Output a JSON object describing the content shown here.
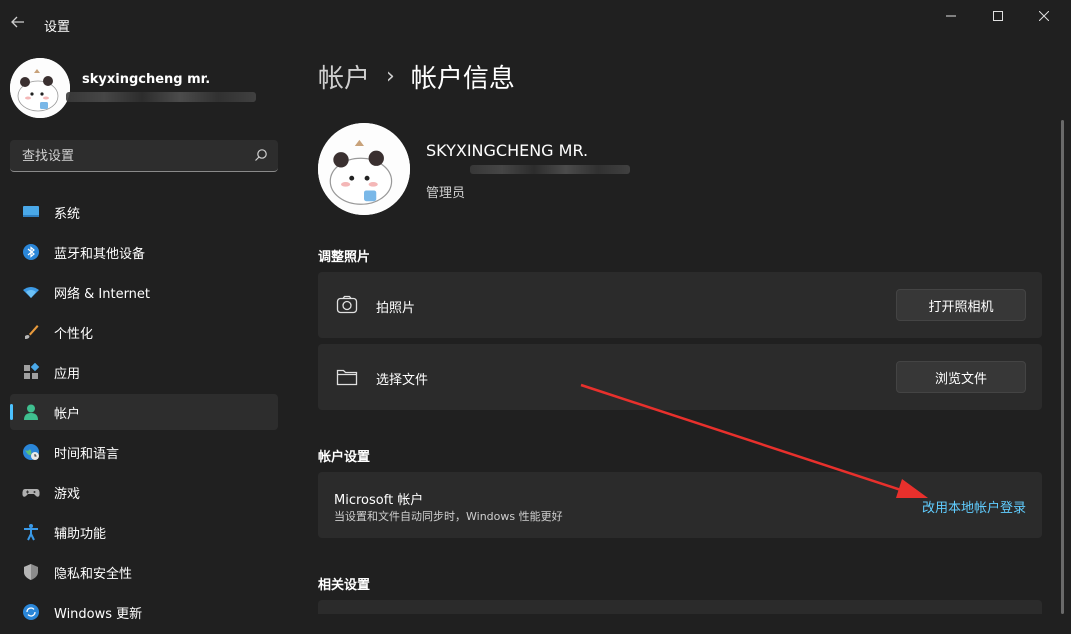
{
  "titlebar": {
    "app_title": "设置",
    "back_icon": "back-arrow-icon"
  },
  "user": {
    "display_name": "skyxingcheng mr.",
    "main_name": "SKYXINGCHENG MR.",
    "role": "管理员"
  },
  "search": {
    "placeholder": "查找设置",
    "value": ""
  },
  "sidebar": {
    "items": [
      {
        "label": "系统",
        "icon": "monitor-icon"
      },
      {
        "label": "蓝牙和其他设备",
        "icon": "bluetooth-icon"
      },
      {
        "label": "网络 & Internet",
        "icon": "wifi-icon"
      },
      {
        "label": "个性化",
        "icon": "brush-icon"
      },
      {
        "label": "应用",
        "icon": "apps-icon"
      },
      {
        "label": "帐户",
        "icon": "account-icon",
        "active": true
      },
      {
        "label": "时间和语言",
        "icon": "globe-clock-icon"
      },
      {
        "label": "游戏",
        "icon": "gamepad-icon"
      },
      {
        "label": "辅助功能",
        "icon": "accessibility-icon"
      },
      {
        "label": "隐私和安全性",
        "icon": "shield-icon"
      },
      {
        "label": "Windows 更新",
        "icon": "update-icon"
      }
    ]
  },
  "breadcrumb": {
    "parent": "帐户",
    "separator": "›",
    "current": "帐户信息"
  },
  "photo_section": {
    "title": "调整照片",
    "take_photo": {
      "label": "拍照片",
      "button": "打开照相机"
    },
    "choose_file": {
      "label": "选择文件",
      "button": "浏览文件"
    }
  },
  "account_settings": {
    "title": "帐户设置",
    "microsoft_account": {
      "title": "Microsoft 帐户",
      "description": "当设置和文件自动同步时，Windows 性能更好",
      "link": "改用本地帐户登录"
    }
  },
  "related": {
    "title": "相关设置"
  },
  "colors": {
    "background": "#202020",
    "card": "#2b2b2b",
    "accent": "#4cc2ff",
    "link": "#60cdff",
    "annotation_arrow": "#e8302c"
  }
}
